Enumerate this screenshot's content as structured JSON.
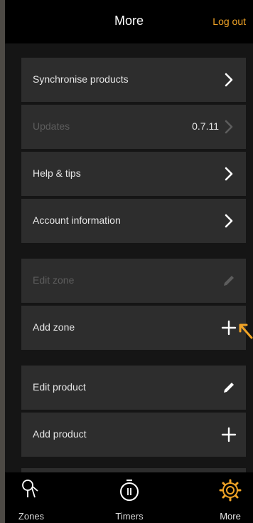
{
  "header": {
    "title": "More",
    "logout_label": "Log out"
  },
  "menu": {
    "synchronise": {
      "label": "Synchronise products"
    },
    "updates": {
      "label": "Updates",
      "value": "0.7.11"
    },
    "help": {
      "label": "Help & tips"
    },
    "account": {
      "label": "Account information"
    },
    "edit_zone": {
      "label": "Edit zone"
    },
    "add_zone": {
      "label": "Add zone"
    },
    "edit_product": {
      "label": "Edit product"
    },
    "add_product": {
      "label": "Add product"
    }
  },
  "tabs": {
    "zones": {
      "label": "Zones",
      "icon": "zones-icon"
    },
    "timers": {
      "label": "Timers",
      "icon": "timer-icon"
    },
    "more": {
      "label": "More",
      "icon": "gear-icon"
    }
  },
  "colors": {
    "accent": "#f0a326",
    "row_bg": "#2d2d2d",
    "screen_bg": "#151515",
    "bar_bg": "#000000",
    "disabled_text": "#5d5d5d"
  }
}
